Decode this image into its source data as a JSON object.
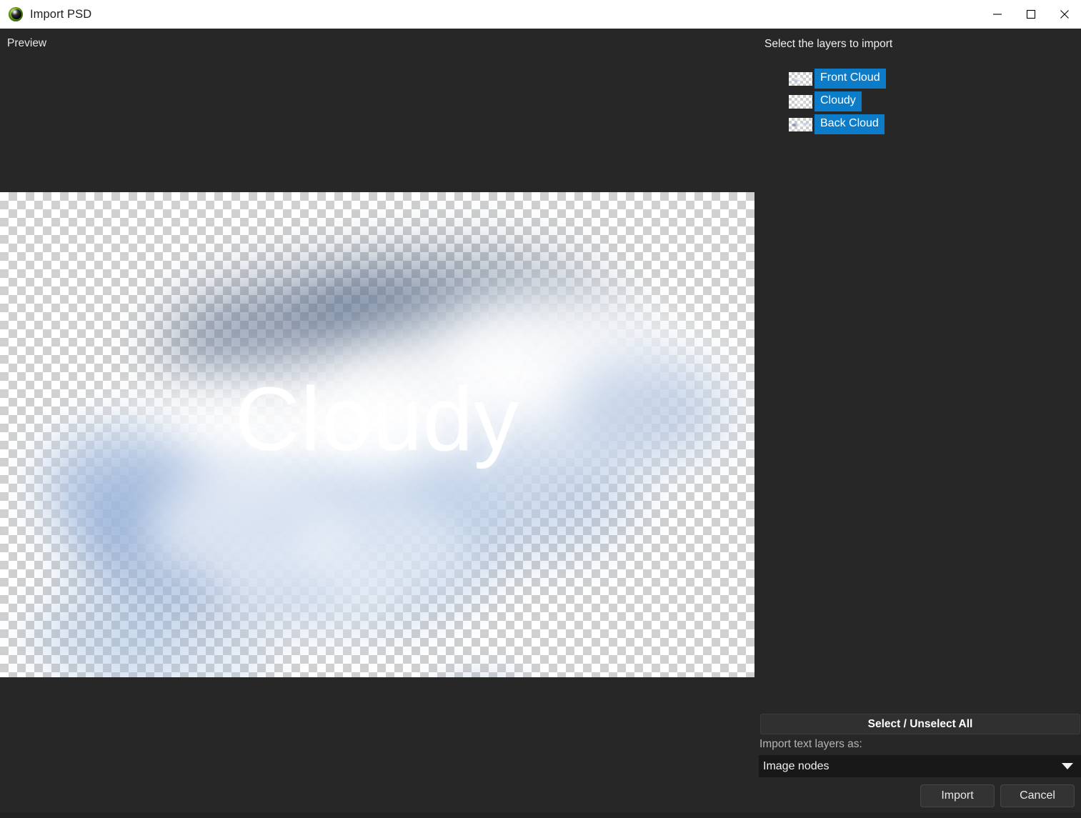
{
  "window": {
    "title": "Import PSD",
    "icon": "krita-app-icon",
    "controls": {
      "minimize": "minimize-icon",
      "maximize": "maximize-icon",
      "close": "close-icon"
    }
  },
  "preview": {
    "label": "Preview",
    "artwork_text": "Cloudy"
  },
  "layers_panel": {
    "heading": "Select the layers to import",
    "selection_color": "#0d7cc8",
    "layers": [
      {
        "name": "Front Cloud",
        "selected": true
      },
      {
        "name": "Cloudy",
        "selected": true
      },
      {
        "name": "Back Cloud",
        "selected": true
      }
    ]
  },
  "controls": {
    "select_unselect_all": "Select / Unselect All",
    "text_layers_label": "Import text layers as:",
    "text_layers_value": "Image nodes",
    "text_layers_options": [
      "Image nodes"
    ],
    "dropdown_icon": "chevron-down-icon",
    "import_button": "Import",
    "cancel_button": "Cancel"
  }
}
